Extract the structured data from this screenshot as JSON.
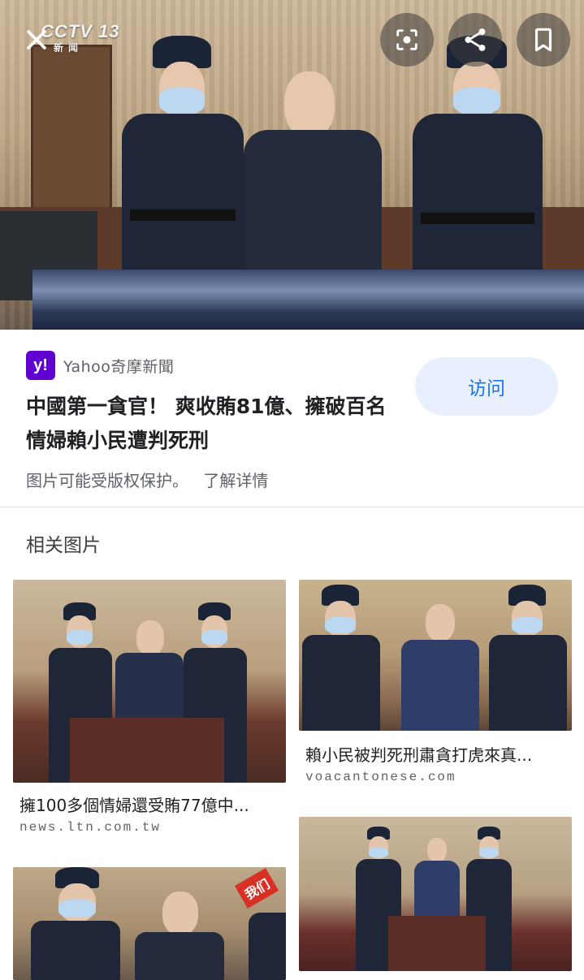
{
  "hero": {
    "watermark_channel": "CCTV 13",
    "watermark_sub": "新闻",
    "close_icon": "close-icon",
    "lens_icon": "lens-icon",
    "share_icon": "share-icon",
    "bookmark_icon": "bookmark-icon"
  },
  "source": {
    "logo_text": "y!",
    "name": "Yahoo奇摩新聞",
    "brand_color": "#6001d2"
  },
  "result": {
    "title": "中國第一貪官！ 爽收賄81億、擁破百名情婦賴小民遭判死刑",
    "visit_label": "访问",
    "copyright_note": "图片可能受版权保护。",
    "learn_more": "了解详情"
  },
  "related": {
    "heading": "相关图片",
    "items": [
      {
        "caption": "擁100多個情婦還受賄77億中...",
        "domain": "news.ltn.com.tw"
      },
      {
        "caption": "賴小民被判死刑肅貪打虎來真...",
        "domain": "voacantonese.com"
      },
      {
        "caption": "",
        "domain": "",
        "badge": "我们"
      },
      {
        "caption": "",
        "domain": ""
      }
    ]
  },
  "colors": {
    "accent": "#1a73e8",
    "visit_bg": "#e8f0fe",
    "text_secondary": "#5f6368"
  }
}
